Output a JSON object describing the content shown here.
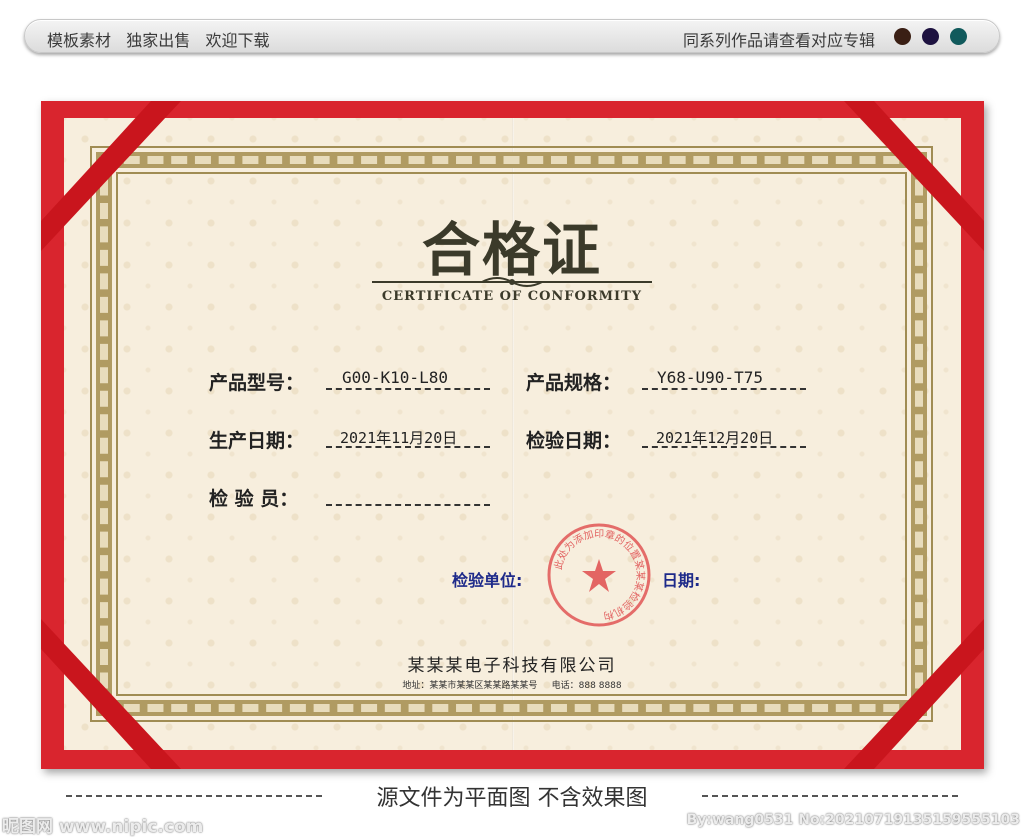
{
  "banner": {
    "left_text": "模板素材   独家出售   欢迎下载",
    "right_text": "同系列作品请查看对应专辑",
    "dots": [
      "#3a1f14",
      "#1d1240",
      "#115a5c"
    ]
  },
  "certificate": {
    "title": "合格证",
    "subtitle": "CERTIFICATE OF CONFORMITY",
    "fields": {
      "model_label": "产品型号：",
      "model_value": "G00-K10-L80",
      "spec_label": "产品规格：",
      "spec_value": "Y68-U90-T75",
      "prod_date_label": "生产日期：",
      "prod_date_value": "2021年11月20日",
      "insp_date_label": "检验日期：",
      "insp_date_value": "2021年12月20日",
      "inspector_label": "检 验 员：",
      "inspector_value": ""
    },
    "unit_label": "检验单位:",
    "date_label": "日期:",
    "seal_text": "此处为添加印章的位置某某某检验机构",
    "company": "某某某电子科技有限公司",
    "address": "地址：某某市某某区某某路某某号     电话：888 8888"
  },
  "footer": {
    "caption": "源文件为平面图 不含效果图",
    "watermark_left": "昵图网 www.nipic.com",
    "watermark_right": "By:wang0531 No:20210719135159555103"
  },
  "colors": {
    "frame_red": "#d9252e",
    "paper": "#f7eedd",
    "gold": "#b09b62",
    "seal_red": "#e05555",
    "label_blue": "#1e2a8a"
  }
}
